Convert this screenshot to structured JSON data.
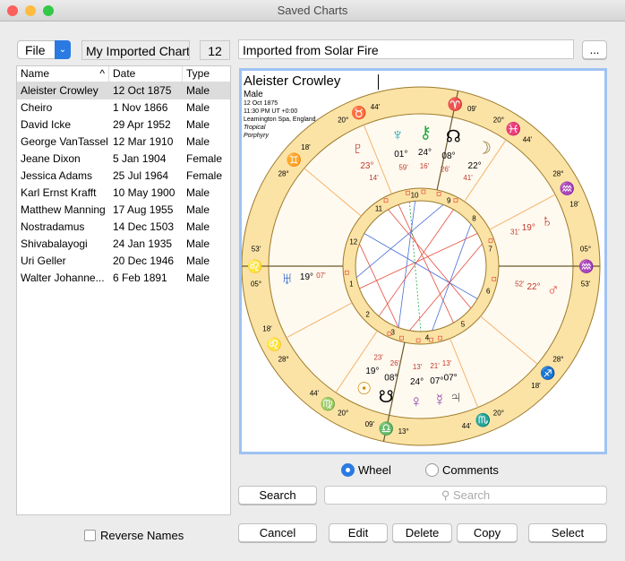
{
  "window": {
    "title": "Saved Charts"
  },
  "toolbar": {
    "file_label": "File",
    "collection_name": "My Imported Charts",
    "count": "12",
    "description": "Imported from Solar Fire",
    "more_label": "..."
  },
  "list": {
    "columns": [
      "Name",
      "Date",
      "Type"
    ],
    "rows": [
      [
        "Aleister Crowley",
        "12 Oct 1875",
        "Male"
      ],
      [
        "Cheiro",
        "1 Nov 1866",
        "Male"
      ],
      [
        "David Icke",
        "29 Apr 1952",
        "Male"
      ],
      [
        "George VanTassel",
        "12 Mar 1910",
        "Male"
      ],
      [
        "Jeane Dixon",
        "5 Jan 1904",
        "Female"
      ],
      [
        "Jessica Adams",
        "25 Jul 1964",
        "Female"
      ],
      [
        "Karl Ernst Krafft",
        "10 May 1900",
        "Male"
      ],
      [
        "Matthew Manning",
        "17 Aug 1955",
        "Male"
      ],
      [
        "Nostradamus",
        "14 Dec 1503",
        "Male"
      ],
      [
        "Shivabalayogi",
        "24 Jan 1935",
        "Male"
      ],
      [
        "Uri Geller",
        "20 Dec 1946",
        "Male"
      ],
      [
        "Walter Johanne...",
        "6 Feb 1891",
        "Male"
      ]
    ],
    "selected": 0
  },
  "chart": {
    "name": "Aleister Crowley",
    "gender": "Male",
    "date": "12 Oct 1875",
    "time": "11:30 PM UT +0:00",
    "place": "Leamington Spa, England",
    "zodiac": "Tropical",
    "houses": "Porphyry",
    "house_numbers": [
      "1",
      "2",
      "3",
      "4",
      "5",
      "6",
      "7",
      "8",
      "9",
      "10",
      "11",
      "12"
    ],
    "cusps": [
      {
        "deg": "05°",
        "sign": "♌",
        "min": "53'"
      },
      {
        "deg": "28°",
        "sign": "♌",
        "min": "18'"
      },
      {
        "deg": "20°",
        "sign": "♍",
        "min": "44'"
      },
      {
        "deg": "13°",
        "sign": "♎",
        "min": "09'"
      },
      {
        "deg": "20°",
        "sign": "♏",
        "min": "44'"
      },
      {
        "deg": "28°",
        "sign": "♐",
        "min": "18'"
      },
      {
        "deg": "05°",
        "sign": "♒",
        "min": "53'"
      },
      {
        "deg": "28°",
        "sign": "♒",
        "min": "18'"
      },
      {
        "deg": "20°",
        "sign": "♓",
        "min": "44'"
      },
      {
        "deg": "",
        "sign": "♈",
        "min": "09'"
      },
      {
        "deg": "20°",
        "sign": "♉",
        "min": "44'"
      },
      {
        "deg": "28°",
        "sign": "♊",
        "min": "18'"
      }
    ],
    "planets": [
      {
        "glyph": "♇",
        "deg": "23°",
        "sign": "♉",
        "min": "14'",
        "color": "#c0392b"
      },
      {
        "glyph": "♆",
        "deg": "01°",
        "sign": "♉",
        "min": "59'",
        "color": "#1aa6b7"
      },
      {
        "glyph": "⚷",
        "deg": "24°",
        "sign": "♈",
        "min": "16'",
        "color": "#27a844"
      },
      {
        "glyph": "☊",
        "deg": "08°",
        "sign": "♈",
        "min": "26'",
        "color": "#000000"
      },
      {
        "glyph": "☽",
        "deg": "22°",
        "sign": "♓",
        "min": "41'",
        "color": "#8a6d1e"
      },
      {
        "glyph": "♄",
        "deg": "19°",
        "sign": "♒",
        "min": "31'",
        "color": "#c0392b"
      },
      {
        "glyph": "♂",
        "deg": "22°",
        "sign": "♑",
        "min": "52'",
        "color": "#e74c3c"
      },
      {
        "glyph": "☋",
        "deg": "08°",
        "sign": "♒",
        "min": "26'",
        "color": "#000000"
      },
      {
        "glyph": "☉",
        "deg": "19°",
        "sign": "♎",
        "min": "23'",
        "color": "#c98a00"
      },
      {
        "glyph": "♀",
        "deg": "24°",
        "sign": "♎",
        "min": "13'",
        "color": "#8e44ad"
      },
      {
        "glyph": "☿",
        "deg": "07°",
        "sign": "♏",
        "min": "21'",
        "color": "#8e44ad"
      },
      {
        "glyph": "♃",
        "deg": "07°",
        "sign": "♏",
        "min": "13'",
        "color": "#555555"
      },
      {
        "glyph": "♅",
        "deg": "19°",
        "sign": "♌",
        "min": "07'",
        "color": "#2962c9"
      }
    ]
  },
  "view": {
    "wheel_label": "Wheel",
    "comments_label": "Comments",
    "selected": "Wheel"
  },
  "search": {
    "button_label": "Search",
    "placeholder": "Search"
  },
  "options": {
    "reverse_names_label": "Reverse Names",
    "reverse_names_checked": false
  },
  "actions": {
    "cancel": "Cancel",
    "edit": "Edit",
    "delete": "Delete",
    "copy": "Copy",
    "select": "Select"
  },
  "colors": {
    "ring": "#fbe3a6",
    "ring_stroke": "#9c7a2a",
    "selection": "#9ec3f3",
    "accent": "#2a7ae2"
  }
}
